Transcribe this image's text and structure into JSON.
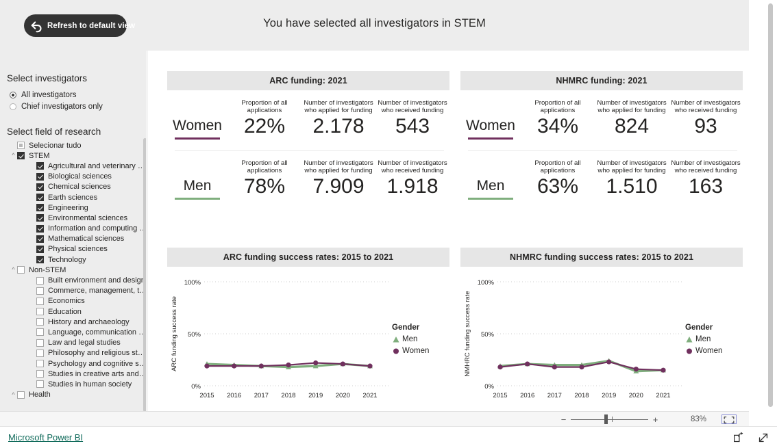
{
  "banner": {
    "refresh_button": "Refresh to default view",
    "refresh_icon": "undo-arrow-icon",
    "title": "You have selected all investigators in STEM"
  },
  "sidebar": {
    "investigators_heading": "Select investigators",
    "investigator_options": [
      {
        "label": "All investigators",
        "selected": true
      },
      {
        "label": "Chief investigators only",
        "selected": false
      }
    ],
    "field_heading": "Select field of research",
    "tree": [
      {
        "label": "Selecionar tudo",
        "state": "partial",
        "level": 0,
        "chevron": ""
      },
      {
        "label": "STEM",
        "state": "checked",
        "level": 0,
        "chevron": "^"
      },
      {
        "label": "Agricultural and veterinary s…",
        "state": "checked",
        "level": 1,
        "chevron": ""
      },
      {
        "label": "Biological sciences",
        "state": "checked",
        "level": 1,
        "chevron": ""
      },
      {
        "label": "Chemical sciences",
        "state": "checked",
        "level": 1,
        "chevron": ""
      },
      {
        "label": "Earth sciences",
        "state": "checked",
        "level": 1,
        "chevron": ""
      },
      {
        "label": "Engineering",
        "state": "checked",
        "level": 1,
        "chevron": ""
      },
      {
        "label": "Environmental sciences",
        "state": "checked",
        "level": 1,
        "chevron": ""
      },
      {
        "label": "Information and computing s…",
        "state": "checked",
        "level": 1,
        "chevron": ""
      },
      {
        "label": "Mathematical sciences",
        "state": "checked",
        "level": 1,
        "chevron": ""
      },
      {
        "label": "Physical sciences",
        "state": "checked",
        "level": 1,
        "chevron": ""
      },
      {
        "label": "Technology",
        "state": "checked",
        "level": 1,
        "chevron": ""
      },
      {
        "label": "Non-STEM",
        "state": "unchecked",
        "level": 0,
        "chevron": "^"
      },
      {
        "label": "Built environment and design",
        "state": "unchecked",
        "level": 1,
        "chevron": ""
      },
      {
        "label": "Commerce, management, to…",
        "state": "unchecked",
        "level": 1,
        "chevron": ""
      },
      {
        "label": "Economics",
        "state": "unchecked",
        "level": 1,
        "chevron": ""
      },
      {
        "label": "Education",
        "state": "unchecked",
        "level": 1,
        "chevron": ""
      },
      {
        "label": "History and archaeology",
        "state": "unchecked",
        "level": 1,
        "chevron": ""
      },
      {
        "label": "Language, communication a…",
        "state": "unchecked",
        "level": 1,
        "chevron": ""
      },
      {
        "label": "Law and legal studies",
        "state": "unchecked",
        "level": 1,
        "chevron": ""
      },
      {
        "label": "Philosophy and religious stu…",
        "state": "unchecked",
        "level": 1,
        "chevron": ""
      },
      {
        "label": "Psychology and cognitive sc…",
        "state": "unchecked",
        "level": 1,
        "chevron": ""
      },
      {
        "label": "Studies in creative arts and …",
        "state": "unchecked",
        "level": 1,
        "chevron": ""
      },
      {
        "label": "Studies in human society",
        "state": "unchecked",
        "level": 1,
        "chevron": ""
      },
      {
        "label": "Health",
        "state": "unchecked",
        "level": 0,
        "chevron": "^"
      }
    ]
  },
  "colors": {
    "women": "#70305E",
    "men": "#7FAE7D",
    "card_header_bg": "#E6E6E6",
    "panel_bg": "#EDEDED",
    "text": "#252423",
    "link": "#0F6A5A"
  },
  "kpi_cards": [
    {
      "title": "ARC funding: 2021",
      "rows": [
        {
          "gender": "Women",
          "metrics": [
            {
              "label": "Proportion of all applications",
              "value": "22%"
            },
            {
              "label": "Number of investigators who applied for funding",
              "value": "2.178"
            },
            {
              "label": "Number of investigators who received funding",
              "value": "543"
            }
          ]
        },
        {
          "gender": "Men",
          "metrics": [
            {
              "label": "Proportion of all applications",
              "value": "78%"
            },
            {
              "label": "Number of investigators who applied for funding",
              "value": "7.909"
            },
            {
              "label": "Number of investigators who received funding",
              "value": "1.918"
            }
          ]
        }
      ]
    },
    {
      "title": "NHMRC funding: 2021",
      "rows": [
        {
          "gender": "Women",
          "metrics": [
            {
              "label": "Proportion of all applications",
              "value": "34%"
            },
            {
              "label": "Number of investigators who applied for funding",
              "value": "824"
            },
            {
              "label": "Number of investigators who received funding",
              "value": "93"
            }
          ]
        },
        {
          "gender": "Men",
          "metrics": [
            {
              "label": "Proportion of all applications",
              "value": "63%"
            },
            {
              "label": "Number of investigators who applied for funding",
              "value": "1.510"
            },
            {
              "label": "Number of investigators who received funding",
              "value": "163"
            }
          ]
        }
      ]
    }
  ],
  "chart_data": [
    {
      "type": "line",
      "title": "ARC funding success rates: 2015 to 2021",
      "xlabel": "",
      "ylabel": "ARC funding success rate",
      "categories": [
        "2015",
        "2016",
        "2017",
        "2018",
        "2019",
        "2020",
        "2021"
      ],
      "yticks": [
        "0%",
        "50%",
        "100%"
      ],
      "ylim": [
        0,
        100
      ],
      "grid": true,
      "legend_title": "Gender",
      "legend_position": "right",
      "series": [
        {
          "name": "Men",
          "color": "#7FAE7D",
          "marker": "triangle",
          "values": [
            21,
            20,
            19,
            18,
            19,
            21,
            19
          ]
        },
        {
          "name": "Women",
          "color": "#70305E",
          "marker": "circle",
          "values": [
            19,
            19,
            19,
            20,
            22,
            21,
            19
          ]
        }
      ]
    },
    {
      "type": "line",
      "title": "NHMRC funding success rates: 2015 to 2021",
      "xlabel": "",
      "ylabel": "NMHRC funding success rate",
      "categories": [
        "2015",
        "2016",
        "2017",
        "2018",
        "2019",
        "2020",
        "2021"
      ],
      "yticks": [
        "0%",
        "50%",
        "100%"
      ],
      "ylim": [
        0,
        100
      ],
      "grid": true,
      "legend_title": "Gender",
      "legend_position": "right",
      "series": [
        {
          "name": "Men",
          "color": "#7FAE7D",
          "marker": "triangle",
          "values": [
            19,
            21,
            20,
            20,
            24,
            14,
            15
          ]
        },
        {
          "name": "Women",
          "color": "#70305E",
          "marker": "circle",
          "values": [
            18,
            21,
            18,
            18,
            23,
            16,
            15
          ]
        }
      ]
    }
  ],
  "statusbar": {
    "minus": "−",
    "plus": "+",
    "zoom_level": "83%",
    "fit_icon": "fit-to-page-icon"
  },
  "footer": {
    "link": "Microsoft Power BI",
    "share_icon": "share-icon",
    "expand_icon": "fullscreen-icon"
  }
}
